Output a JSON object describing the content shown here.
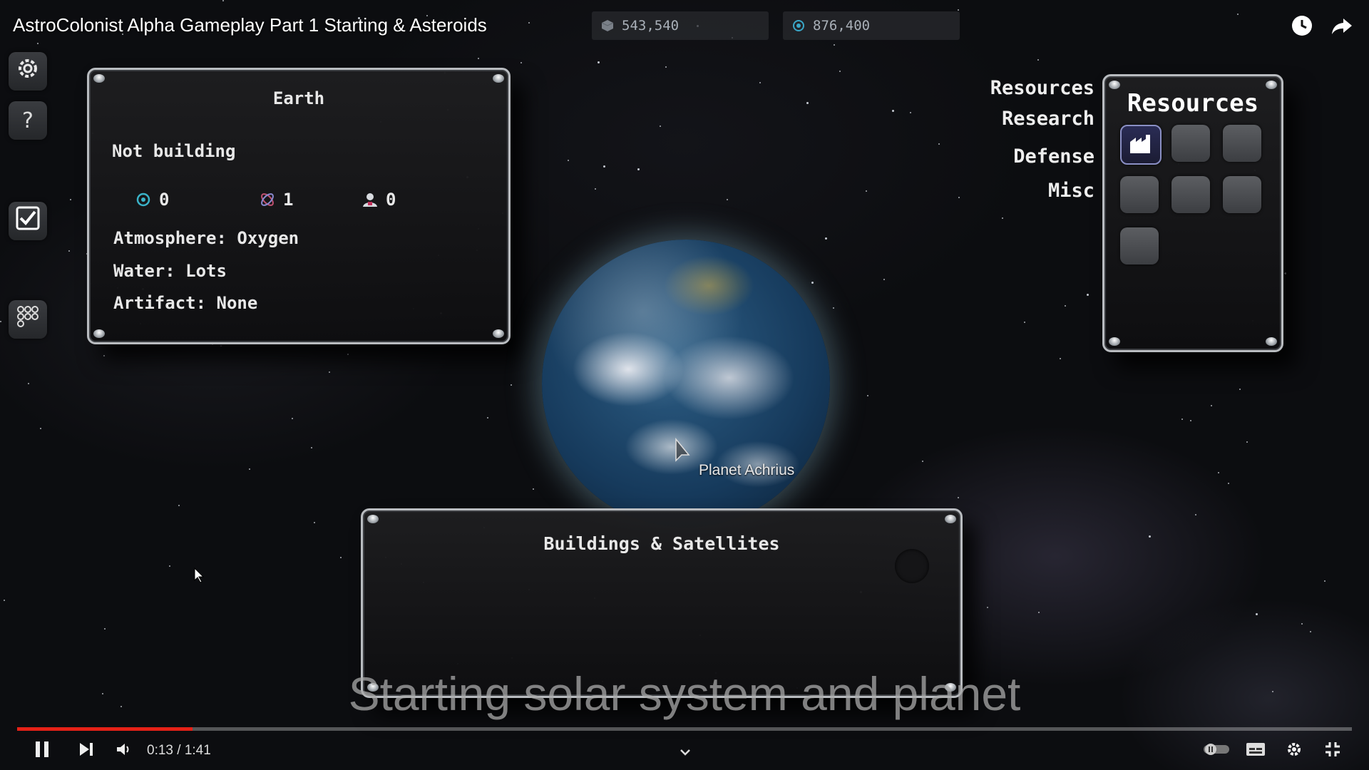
{
  "video": {
    "title": "AstroColonist Alpha Gameplay Part 1 Starting & Asteroids",
    "caption": "Starting solar system and planet",
    "progress": 0.1313,
    "time_current": "0:13",
    "time_total": "1:41",
    "time_display": "0:13 / 1:41"
  },
  "resources_bar": {
    "metal": "543,540",
    "energy": "876,400"
  },
  "sidebar": {
    "help_label": "?"
  },
  "earth_panel": {
    "title": "Earth",
    "status": "Not building",
    "stats": [
      "0",
      "1",
      "0"
    ],
    "atmosphere": "Atmosphere: Oxygen",
    "water": "Water: Lots",
    "artifact": "Artifact: None"
  },
  "categories": [
    "Resources",
    "Research",
    "Defense",
    "Misc"
  ],
  "resources_panel": {
    "title": "Resources",
    "slot_count": 7
  },
  "planet": {
    "label": "Planet Achrius"
  },
  "buildings_panel": {
    "title": "Buildings & Satellites"
  },
  "colors": {
    "progress": "#e62117",
    "panel_border": "#b9bcc0",
    "background": "#0c0d10"
  }
}
